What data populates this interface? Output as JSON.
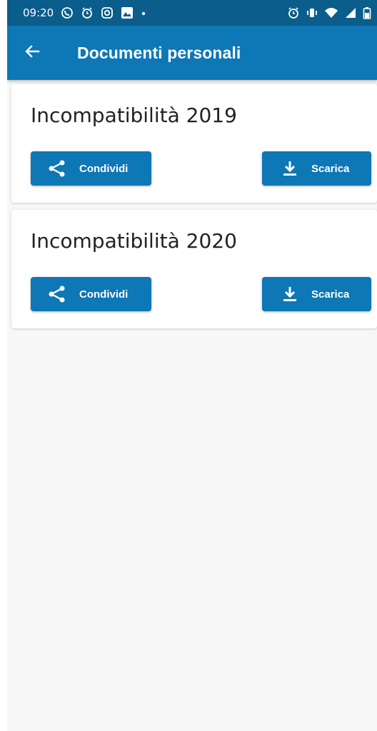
{
  "status_bar": {
    "time": "09:20",
    "left_icons": [
      "whatsapp-icon",
      "alarm-icon",
      "instagram-icon",
      "gallery-icon",
      "dot-icon"
    ],
    "right_icons": [
      "alarm-icon",
      "vibrate-icon",
      "wifi-icon",
      "signal-icon",
      "battery-icon"
    ]
  },
  "app_bar": {
    "title": "Documenti personali",
    "back_icon": "arrow-left-icon",
    "color": "#0e77b5"
  },
  "documents": [
    {
      "title": "Incompatibilità 2019",
      "share_label": "Condividi",
      "download_label": "Scarica"
    },
    {
      "title": "Incompatibilità 2020",
      "share_label": "Condividi",
      "download_label": "Scarica"
    }
  ],
  "colors": {
    "primary": "#0e77b5",
    "status_bar": "#0b5d8c",
    "background": "#f7f7f7"
  }
}
